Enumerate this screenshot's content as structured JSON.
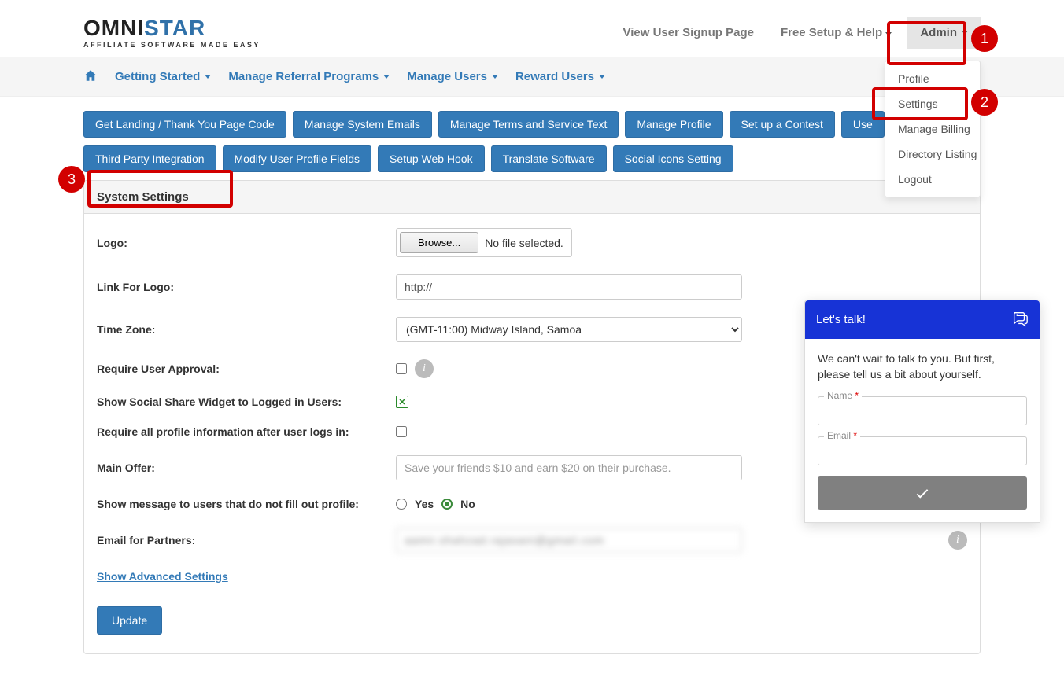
{
  "logo": {
    "line1_a": "OMNI",
    "line1_b": "STAR",
    "tagline": "AFFILIATE SOFTWARE MADE EASY"
  },
  "topnav": {
    "view_signup": "View User Signup Page",
    "free_setup": "Free Setup & Help",
    "admin": "Admin"
  },
  "admin_menu": {
    "profile": "Profile",
    "settings": "Settings",
    "billing": "Manage Billing",
    "directory": "Directory Listing",
    "logout": "Logout"
  },
  "mainnav": {
    "getting_started": "Getting Started",
    "manage_programs": "Manage Referral Programs",
    "manage_users": "Manage Users",
    "reward_users": "Reward Users"
  },
  "setting_buttons": {
    "r1": {
      "landing": "Get Landing / Thank You Page Code",
      "emails": "Manage System Emails",
      "terms": "Manage Terms and Service Text",
      "profile": "Manage Profile",
      "contest": "Set up a Contest",
      "use": "Use"
    },
    "r2": {
      "third_party": "Third Party Integration",
      "modify_fields": "Modify User Profile Fields",
      "webhook": "Setup Web Hook",
      "translate": "Translate Software",
      "social": "Social Icons Setting"
    }
  },
  "panel": {
    "title": "System Settings"
  },
  "form": {
    "logo_label": "Logo:",
    "browse": "Browse...",
    "no_file": "No file selected.",
    "link_label": "Link For Logo:",
    "link_value": "http://",
    "tz_label": "Time Zone:",
    "tz_value": "(GMT-11:00) Midway Island, Samoa",
    "approval_label": "Require User Approval:",
    "social_label": "Show Social Share Widget to Logged in Users:",
    "profile_req_label": "Require all profile information after user logs in:",
    "main_offer_label": "Main Offer:",
    "main_offer_placeholder": "Save your friends $10 and earn $20 on their purchase.",
    "msg_label": "Show message to users that do not fill out profile:",
    "yes": "Yes",
    "no": "No",
    "partners_label": "Email for Partners:",
    "partners_value": "aamir.shahzad.rajasani@gmail.com",
    "advanced": "Show Advanced Settings",
    "update": "Update"
  },
  "chat": {
    "title": "Let's talk!",
    "body": "We can't wait to talk to you. But first, please tell us a bit about yourself.",
    "name": "Name",
    "email": "Email",
    "req": "*"
  },
  "annotations": {
    "n1": "1",
    "n2": "2",
    "n3": "3"
  }
}
